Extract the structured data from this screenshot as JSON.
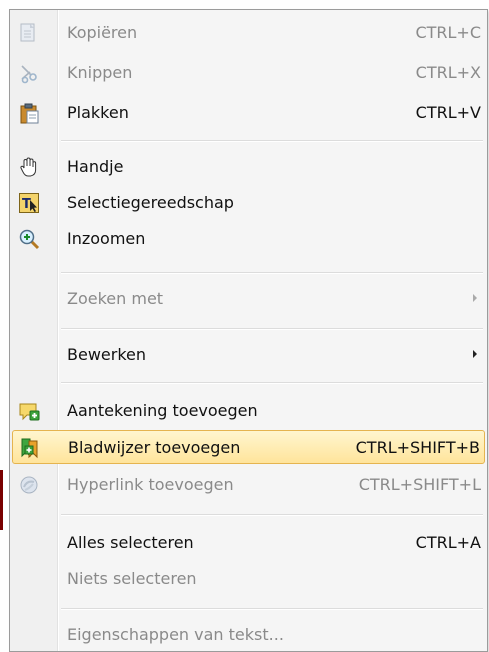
{
  "menu": {
    "items": [
      {
        "label": "Kopiëren",
        "shortcut": "CTRL+C"
      },
      {
        "label": "Knippen",
        "shortcut": "CTRL+X"
      },
      {
        "label": "Plakken",
        "shortcut": "CTRL+V"
      },
      {
        "label": "Handje"
      },
      {
        "label": "Selectiegereedschap"
      },
      {
        "label": "Inzoomen"
      },
      {
        "label": "Zoeken met"
      },
      {
        "label": "Bewerken"
      },
      {
        "label": "Aantekening toevoegen"
      },
      {
        "label": "Bladwijzer toevoegen",
        "shortcut": "CTRL+SHIFT+B"
      },
      {
        "label": "Hyperlink toevoegen",
        "shortcut": "CTRL+SHIFT+L"
      },
      {
        "label": "Alles selecteren",
        "shortcut": "CTRL+A"
      },
      {
        "label": "Niets selecteren"
      },
      {
        "label": "Eigenschappen van tekst..."
      }
    ]
  },
  "icons": {
    "copy": "copy-icon",
    "cut": "scissors-icon",
    "paste": "clipboard-icon",
    "hand": "hand-icon",
    "select": "text-select-icon",
    "zoom": "zoom-in-icon",
    "note": "add-note-icon",
    "bookmark": "bookmark-icon",
    "hyperlink": "hyperlink-icon"
  },
  "colors": {
    "highlight": "#ffe49b",
    "highlight_border": "#e5b44f",
    "disabled_text": "#8a8a8a"
  }
}
